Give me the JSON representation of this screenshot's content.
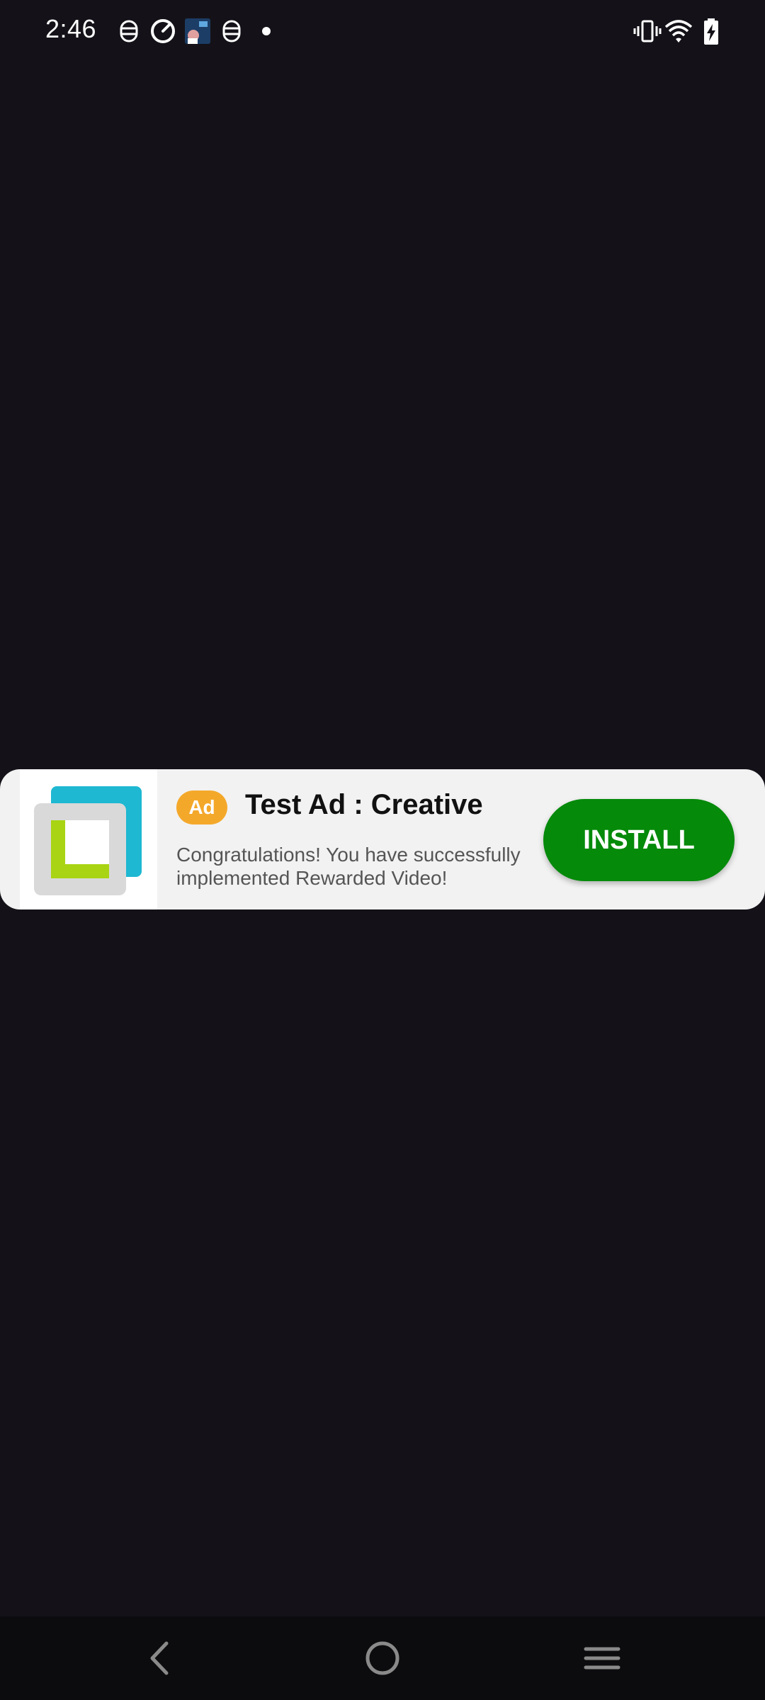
{
  "status_bar": {
    "time": "2:46",
    "left_icons": [
      "notification-icon",
      "speedometer-icon",
      "app-thumbnail-icon",
      "notification-icon",
      "more-dot-icon"
    ],
    "right_icons": [
      "vibrate-icon",
      "wifi-icon",
      "battery-charging-icon"
    ]
  },
  "ad": {
    "badge": "Ad",
    "title": "Test Ad : Creative",
    "description": "Congratulations! You have successfully implemented Rewarded Video!",
    "cta": "INSTALL",
    "colors": {
      "background": "#f2f2f2",
      "badge": "#f4a82a",
      "cta": "#058a0a"
    }
  },
  "nav_bar": {
    "buttons": [
      "back-icon",
      "home-icon",
      "recents-icon"
    ]
  },
  "colors": {
    "screen_background": "#141218"
  }
}
